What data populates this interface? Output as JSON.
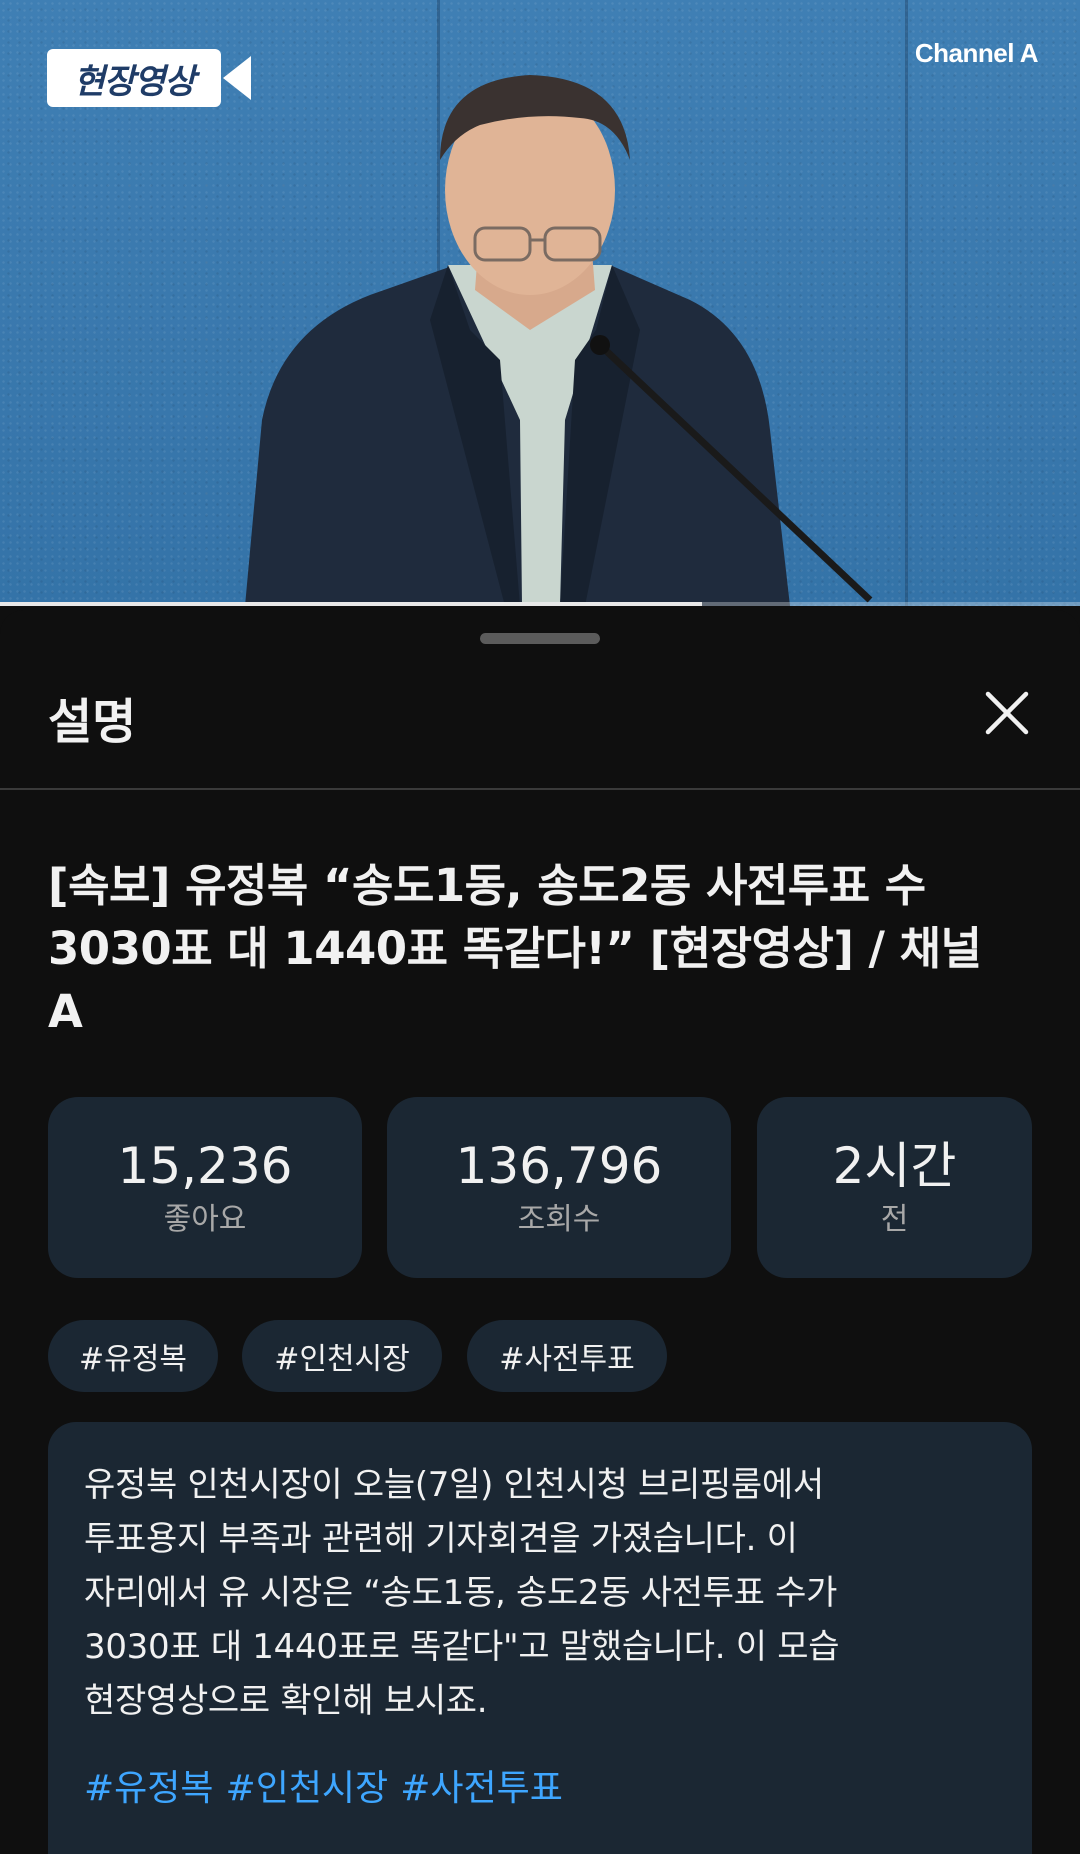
{
  "video": {
    "overlay_badge": "현장영상",
    "channel_brand": "Channel A",
    "progress_fraction": 0.65
  },
  "sheet": {
    "title": "설명",
    "close_icon": "close-icon",
    "video_title": "[속보] 유정복 “송도1동, 송도2동 사전투표 수 3030표 대 1440표 똑같다!” [현장영상] / 채널A",
    "stats": [
      {
        "value": "15,236",
        "label": "좋아요"
      },
      {
        "value": "136,796",
        "label": "조회수"
      },
      {
        "value": "2시간",
        "label": "전"
      }
    ],
    "chips": [
      "#유정복",
      "#인천시장",
      "#사전투표"
    ],
    "description": {
      "lines": [
        "유정복 인천시장이 오늘(7일) 인천시청 브리핑룸에서",
        "투표용지 부족과 관련해 기자회견을 가졌습니다. 이",
        "자리에서 유 시장은 “송도1동, 송도2동 사전투표 수가",
        "3030표 대 1440표로 똑같다\"고 말했습니다. 이 모습",
        "현장영상으로 확인해 보시죠."
      ],
      "hashtags": [
        "#유정복",
        "#인천시장",
        "#사전투표"
      ]
    }
  },
  "colors": {
    "background": "#0f0f0f",
    "card": "#1b2733",
    "hashtag_link": "#3ea6ff",
    "video_backdrop": "#3a79ae"
  }
}
